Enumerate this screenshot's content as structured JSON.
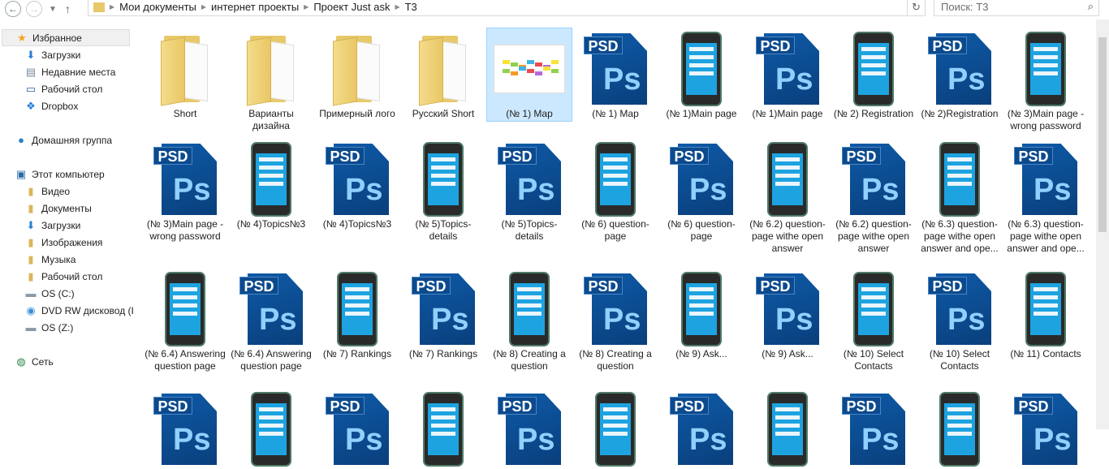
{
  "toolbar": {
    "back": "back-icon",
    "forward": "forward-icon",
    "recent": "chevron-down-icon",
    "up": "up-arrow-icon"
  },
  "breadcrumb": [
    "Мои документы",
    "интернет проекты",
    "Проект Just ask",
    "Т3"
  ],
  "search": {
    "placeholder": "Поиск: Т3"
  },
  "sidebar": [
    {
      "label": "Избранное",
      "icon": "star-icon",
      "level": 0,
      "selected": true
    },
    {
      "label": "Загрузки",
      "icon": "downloads-icon",
      "level": 1
    },
    {
      "label": "Недавние места",
      "icon": "recent-places-icon",
      "level": 1
    },
    {
      "label": "Рабочий стол",
      "icon": "desktop-icon",
      "level": 1
    },
    {
      "label": "Dropbox",
      "icon": "dropbox-icon",
      "level": 1
    },
    {
      "label": "Домашняя группа",
      "icon": "homegroup-icon",
      "level": 0,
      "gap": true
    },
    {
      "label": "Этот компьютер",
      "icon": "computer-icon",
      "level": 0,
      "gap": true
    },
    {
      "label": "Видео",
      "icon": "video-folder-icon",
      "level": 1
    },
    {
      "label": "Документы",
      "icon": "documents-folder-icon",
      "level": 1
    },
    {
      "label": "Загрузки",
      "icon": "downloads-icon",
      "level": 1
    },
    {
      "label": "Изображения",
      "icon": "pictures-folder-icon",
      "level": 1
    },
    {
      "label": "Музыка",
      "icon": "music-folder-icon",
      "level": 1
    },
    {
      "label": "Рабочий стол",
      "icon": "desktop-folder-icon",
      "level": 1
    },
    {
      "label": "OS (C:)",
      "icon": "drive-icon",
      "level": 1
    },
    {
      "label": "DVD RW дисковод (I",
      "icon": "dvd-icon",
      "level": 1
    },
    {
      "label": "OS (Z:)",
      "icon": "drive-icon",
      "level": 1
    },
    {
      "label": "Сеть",
      "icon": "network-icon",
      "level": 0,
      "gap": true
    }
  ],
  "files": [
    {
      "name": "Short",
      "type": "folder"
    },
    {
      "name": "Варианты дизайна",
      "type": "folder"
    },
    {
      "name": "Примерный лого",
      "type": "folder"
    },
    {
      "name": "Русский Short",
      "type": "folder"
    },
    {
      "name": "(№ 1) Map",
      "type": "map",
      "selected": true
    },
    {
      "name": "(№ 1) Map",
      "type": "psd"
    },
    {
      "name": "(№ 1)Main page",
      "type": "phone"
    },
    {
      "name": "(№ 1)Main page",
      "type": "psd"
    },
    {
      "name": "(№ 2) Registration",
      "type": "phone"
    },
    {
      "name": "(№ 2)Registration",
      "type": "psd"
    },
    {
      "name": "(№ 3)Main page -wrong password",
      "type": "phone"
    },
    {
      "name": "(№ 3)Main page -wrong password",
      "type": "psd"
    },
    {
      "name": "(№ 4)Topics№3",
      "type": "phone"
    },
    {
      "name": "(№ 4)Topics№3",
      "type": "psd"
    },
    {
      "name": "(№ 5)Topics-details",
      "type": "phone"
    },
    {
      "name": "(№ 5)Topics-details",
      "type": "psd"
    },
    {
      "name": "(№ 6) question-page",
      "type": "phone"
    },
    {
      "name": "(№ 6) question-page",
      "type": "psd"
    },
    {
      "name": "(№ 6.2) question-page withe open answer",
      "type": "phone"
    },
    {
      "name": "(№ 6.2) question-page withe open answer",
      "type": "psd"
    },
    {
      "name": "(№ 6.3) question-page withe open answer and ope...",
      "type": "phone"
    },
    {
      "name": "(№ 6.3) question-page withe open answer and ope...",
      "type": "psd"
    },
    {
      "name": "(№ 6.4) Answering question page",
      "type": "phone"
    },
    {
      "name": "(№ 6.4) Answering question page",
      "type": "psd"
    },
    {
      "name": "(№ 7) Rankings",
      "type": "phone"
    },
    {
      "name": "(№ 7) Rankings",
      "type": "psd"
    },
    {
      "name": "(№ 8) Creating a question",
      "type": "phone"
    },
    {
      "name": "(№ 8) Creating a question",
      "type": "psd"
    },
    {
      "name": "(№ 9) Ask...",
      "type": "phone"
    },
    {
      "name": "(№ 9) Ask...",
      "type": "psd"
    },
    {
      "name": "(№ 10) Select Contacts",
      "type": "phone"
    },
    {
      "name": "(№ 10) Select Contacts",
      "type": "psd"
    },
    {
      "name": "(№ 11) Contacts",
      "type": "phone"
    },
    {
      "name": "",
      "type": "psd"
    },
    {
      "name": "",
      "type": "phone"
    },
    {
      "name": "",
      "type": "psd"
    },
    {
      "name": "",
      "type": "phone"
    },
    {
      "name": "",
      "type": "psd"
    },
    {
      "name": "",
      "type": "phone"
    },
    {
      "name": "",
      "type": "psd"
    },
    {
      "name": "",
      "type": "phone"
    },
    {
      "name": "",
      "type": "psd"
    },
    {
      "name": "",
      "type": "phone"
    },
    {
      "name": "",
      "type": "psd"
    }
  ],
  "psd_tag": "PSD",
  "psd_glyph": "Ps"
}
